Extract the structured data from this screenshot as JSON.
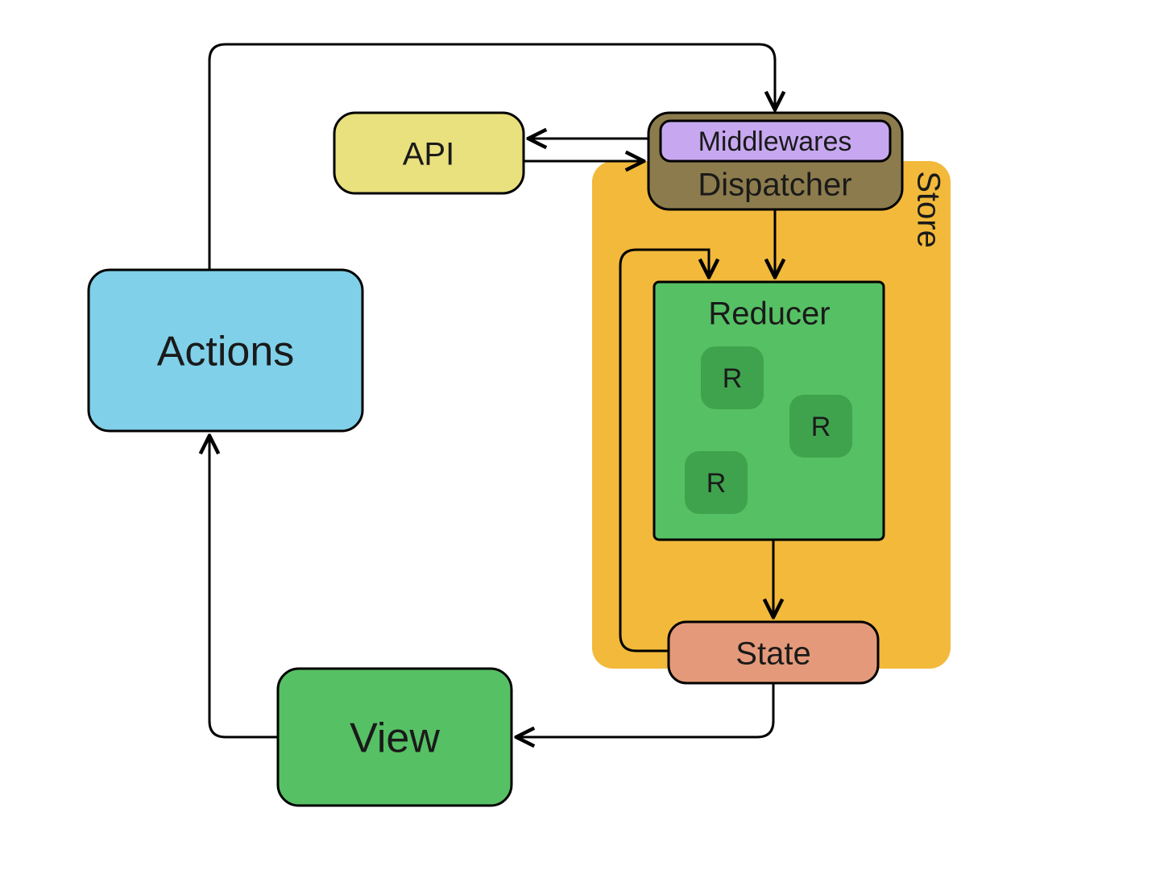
{
  "diagram": {
    "actions": {
      "label": "Actions"
    },
    "api": {
      "label": "API"
    },
    "dispatcher": {
      "label": "Dispatcher",
      "middlewares": {
        "label": "Middlewares"
      }
    },
    "store": {
      "label": "Store",
      "reducer": {
        "label": "Reducer",
        "items": [
          "R",
          "R",
          "R"
        ]
      },
      "state": {
        "label": "State"
      }
    },
    "view": {
      "label": "View"
    }
  },
  "colors": {
    "actions": "#7fd0e8",
    "api": "#e9e07e",
    "dispatcher": "#8c7b4c",
    "middlewares": "#c7a8f0",
    "store": "#f2b93b",
    "reducer": "#56c064",
    "reducer_item": "#3fa34d",
    "state": "#e49a7a",
    "view": "#56c064",
    "stroke": "#000000"
  }
}
